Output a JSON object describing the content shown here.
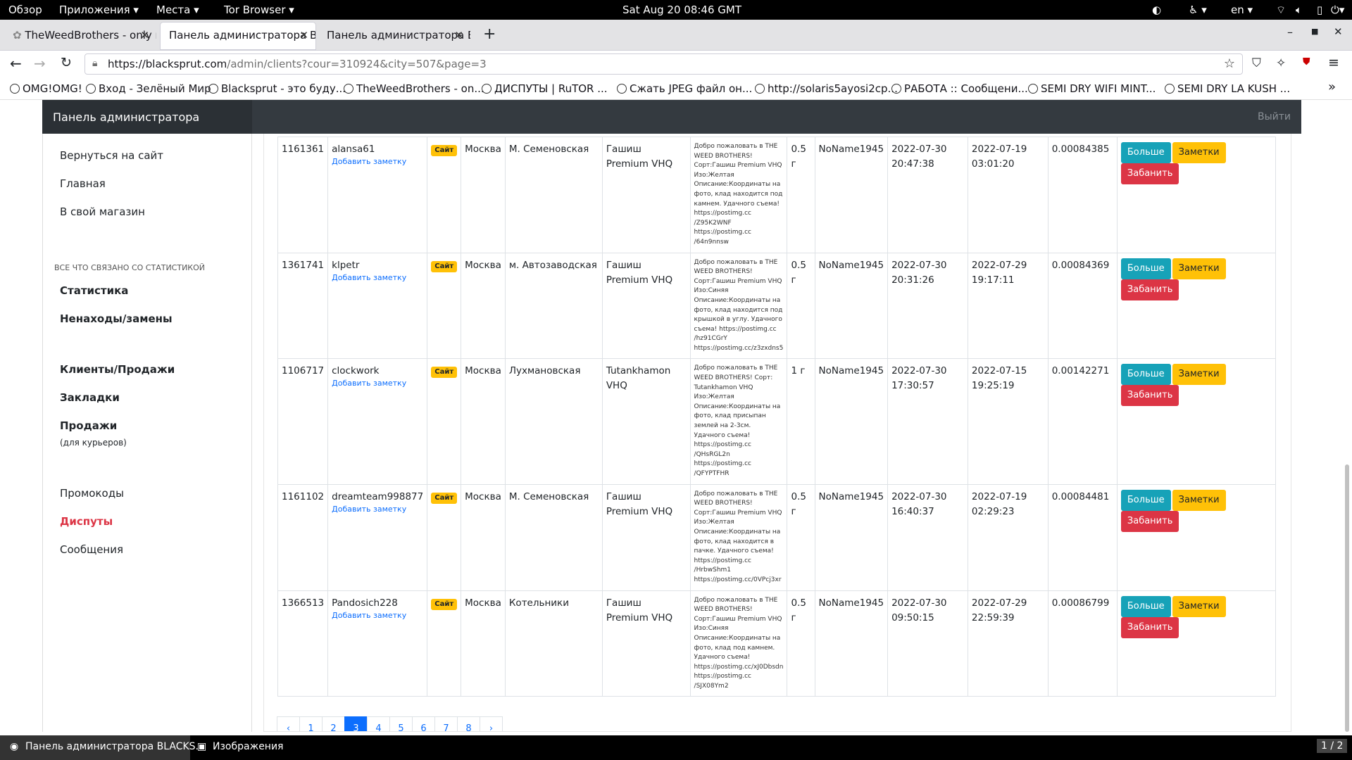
{
  "topbar": {
    "overview": "Обзор",
    "apps": "Приложения ▾",
    "places": "Места ▾",
    "tor": "Tor Browser ▾",
    "clock": "Sat Aug 20  08:46 GMT",
    "lang": "en ▾"
  },
  "tabs": [
    {
      "label": "TheWeedBrothers - only r"
    },
    {
      "label": "Панель администратора BL"
    },
    {
      "label": "Панель администратора BL"
    }
  ],
  "nav": {
    "url_host": "https://blacksprut.com",
    "url_path": "/admin/clients?cour=310924&city=507&page=3"
  },
  "bookmarks": [
    "OMG!OMG!",
    "Вход - Зелёный Мир",
    "Blacksprut - это буду...",
    "TheWeedBrothers - on...",
    "ДИСПУТЫ | RuTOR ...",
    "Сжать JPEG файл он...",
    "http://solaris5ayosi2cp...",
    "РАБОТА :: Сообщени...",
    "SEMI DRY WIFI MINT...",
    "SEMI DRY LA KUSH ..."
  ],
  "admin": {
    "brand": "Панель администратора",
    "logout": "Выйти"
  },
  "sidebar": {
    "back": "Вернуться на сайт",
    "main": "Главная",
    "shop": "В свой магазин",
    "stats_header": "ВСЕ ЧТО СВЯЗАНО СО СТАТИСТИКОЙ",
    "stats": "Статистика",
    "misses": "Ненаходы/замены",
    "clients": "Клиенты/Продажи",
    "bookmarks": "Закладки",
    "sales": "Продажи",
    "sales_sub": "(для курьеров)",
    "promo": "Промокоды",
    "disputes": "Диспуты",
    "messages": "Сообщения"
  },
  "table": {
    "rows": [
      {
        "id": "1161361",
        "user": "alansa61",
        "note": "Добавить заметку",
        "src": "Сайт",
        "city": "Москва",
        "district": "М. Семеновская",
        "product": "Гашиш Premium VHQ",
        "desc": "Добро пожаловать в THE WEED BROTHERS! Сорт:Гашиш Premium VHQ Изо:Желтая Описание:Координаты на фото, клад находится под камнем. Удачного съема! https://postimg.cc /Z95K2WNF https://postimg.cc /64n9nnsw",
        "qty": "0.5 г",
        "courier": "NoName1945",
        "date1": "2022-07-30 20:47:38",
        "date2": "2022-07-19 03:01:20",
        "price": "0.00084385"
      },
      {
        "id": "1361741",
        "user": "klpetr",
        "note": "Добавить заметку",
        "src": "Сайт",
        "city": "Москва",
        "district": "м. Автозаводская",
        "product": "Гашиш Premium VHQ",
        "desc": "Добро пожаловать в THE WEED BROTHERS! Сорт:Гашиш Premium VHQ Изо:Синяя Описание:Координаты на фото, клад находится под крышкой в углу. Удачного съема! https://postimg.cc /hz91CGrY https://postimg.cc/z3zxdns5",
        "qty": "0.5 г",
        "courier": "NoName1945",
        "date1": "2022-07-30 20:31:26",
        "date2": "2022-07-29 19:17:11",
        "price": "0.00084369"
      },
      {
        "id": "1106717",
        "user": "clockwork",
        "note": "Добавить заметку",
        "src": "Сайт",
        "city": "Москва",
        "district": "Лухмановская",
        "product": "Tutankhamon VHQ",
        "desc": "Добро пожаловать в THE WEED BROTHERS! Сорт: Tutankhamon VHQ Изо:Желтая Описание:Координаты на фото, клад присыпан землей на 2-3см. Удачного съема! https://postimg.cc /QHsRGL2n https://postimg.cc /QFYPTFHR",
        "qty": "1 г",
        "courier": "NoName1945",
        "date1": "2022-07-30 17:30:57",
        "date2": "2022-07-15 19:25:19",
        "price": "0.00142271"
      },
      {
        "id": "1161102",
        "user": "dreamteam998877",
        "note": "Добавить заметку",
        "src": "Сайт",
        "city": "Москва",
        "district": "М. Семеновская",
        "product": "Гашиш Premium VHQ",
        "desc": "Добро пожаловать в THE WEED BROTHERS! Сорт:Гашиш Premium VHQ Изо:Желтая Описание:Координаты на фото, клад находится в пачке. Удачного съема! https://postimg.cc /HrbwShm1 https://postimg.cc/0VPcj3xr",
        "qty": "0.5 г",
        "courier": "NoName1945",
        "date1": "2022-07-30 16:40:37",
        "date2": "2022-07-19 02:29:23",
        "price": "0.00084481"
      },
      {
        "id": "1366513",
        "user": "Pandosich228",
        "note": "Добавить заметку",
        "src": "Сайт",
        "city": "Москва",
        "district": "Котельники",
        "product": "Гашиш Premium VHQ",
        "desc": "Добро пожаловать в THE WEED BROTHERS! Сорт:Гашиш Premium VHQ Изо:Синяя Описание:Координаты на фото, клад под камнем. Удачного съема! https://postimg.cc/xJ0Dbsdn https://postimg.cc /SJX08Ym2",
        "qty": "0.5 г",
        "courier": "NoName1945",
        "date1": "2022-07-30 09:50:15",
        "date2": "2022-07-29 22:59:39",
        "price": "0.00086799"
      }
    ],
    "btn_more": "Больше",
    "btn_notes": "Заметки",
    "btn_ban": "Забанить"
  },
  "pagination": {
    "prev": "‹",
    "pages": [
      "1",
      "2",
      "3",
      "4",
      "5",
      "6",
      "7",
      "8"
    ],
    "next": "›",
    "current": "3"
  },
  "taskbar": {
    "window": "Панель администратора BLACKS...",
    "images": "Изображения",
    "workspace": "1 / 2"
  }
}
